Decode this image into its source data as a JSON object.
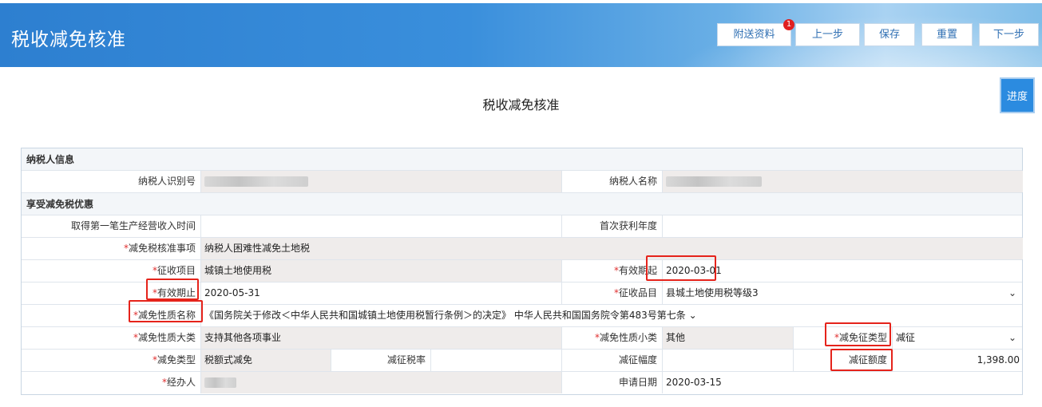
{
  "header": {
    "title": "税收减免核准",
    "buttons": {
      "attach": "附送资料",
      "prev": "上一步",
      "save": "保存",
      "reset": "重置",
      "next": "下一步"
    },
    "attach_badge": "1"
  },
  "page_title": "税收减免核准",
  "progress_button": "进度",
  "sections": {
    "taxpayer_info": "纳税人信息",
    "enjoy_relief": "享受减免税优惠"
  },
  "fields": {
    "taxpayer_id_label": "纳税人识别号",
    "taxpayer_name_label": "纳税人名称",
    "first_income_time_label": "取得第一笔生产经营收入时间",
    "first_profit_year_label": "首次获利年度",
    "relief_item_label": "减免税核准事项",
    "relief_item_value": "纳税人困难性减免土地税",
    "levy_project_label": "征收项目",
    "levy_project_value": "城镇土地使用税",
    "valid_from_label": "有效期起",
    "valid_from_value": "2020-03-01",
    "valid_to_label": "有效期止",
    "valid_to_value": "2020-05-31",
    "levy_item_label": "征收品目",
    "levy_item_value": "县城土地使用税等级3",
    "relief_nature_name_label": "减免性质名称",
    "relief_nature_name_value": "《国务院关于修改＜中华人民共和国城镇土地使用税暂行条例＞的决定》 中华人民共和国国务院令第483号第七条",
    "relief_nature_major_label": "减免性质大类",
    "relief_nature_major_value": "支持其他各项事业",
    "relief_nature_minor_label": "减免性质小类",
    "relief_nature_minor_value": "其他",
    "relief_levy_type_label": "减免征类型",
    "relief_levy_type_value": "减征",
    "relief_type_label": "减免类型",
    "relief_type_value": "税额式减免",
    "reduced_rate_label": "减征税率",
    "reduced_range_label": "减征幅度",
    "reduced_amount_label": "减征额度",
    "reduced_amount_value": "1,398.00",
    "handler_label": "经办人",
    "apply_date_label": "申请日期",
    "apply_date_value": "2020-03-15"
  },
  "required_mark": "*"
}
